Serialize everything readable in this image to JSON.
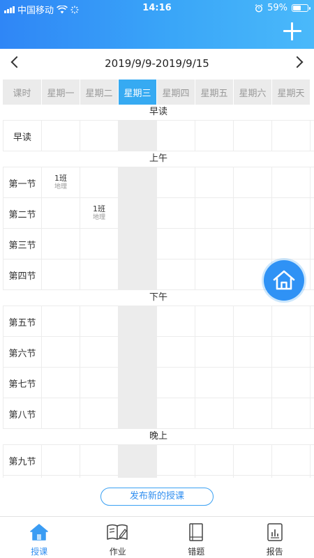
{
  "status": {
    "carrier": "中国移动",
    "time": "14:16",
    "battery": "59%",
    "battery_level": 0.59
  },
  "week": {
    "range": "2019/9/9-2019/9/15"
  },
  "tabs": [
    "课时",
    "星期一",
    "星期二",
    "星期三",
    "星期四",
    "星期五",
    "星期六",
    "星期天"
  ],
  "active_day_index": 3,
  "sections": [
    {
      "title": "早读",
      "periods": [
        "早读"
      ]
    },
    {
      "title": "上午",
      "periods": [
        "第一节",
        "第二节",
        "第三节",
        "第四节"
      ]
    },
    {
      "title": "下午",
      "periods": [
        "第五节",
        "第六节",
        "第七节",
        "第八节"
      ]
    },
    {
      "title": "晚上",
      "periods": [
        "第九节",
        ""
      ]
    }
  ],
  "lessons": [
    {
      "section": 1,
      "period": 0,
      "day": 0,
      "class_name": "1班",
      "subject": "地理"
    },
    {
      "section": 1,
      "period": 1,
      "day": 1,
      "class_name": "1班",
      "subject": "地理"
    }
  ],
  "publish_label": "发布新的授课",
  "nav": [
    {
      "label": "授课",
      "icon": "home-icon",
      "active": true
    },
    {
      "label": "作业",
      "icon": "book-pen-icon",
      "active": false
    },
    {
      "label": "错题",
      "icon": "notebook-icon",
      "active": false
    },
    {
      "label": "报告",
      "icon": "report-icon",
      "active": false
    }
  ],
  "colors": {
    "accent": "#2f8ef0",
    "active_tab": "#36aaf2",
    "today_column": "#ececec"
  }
}
